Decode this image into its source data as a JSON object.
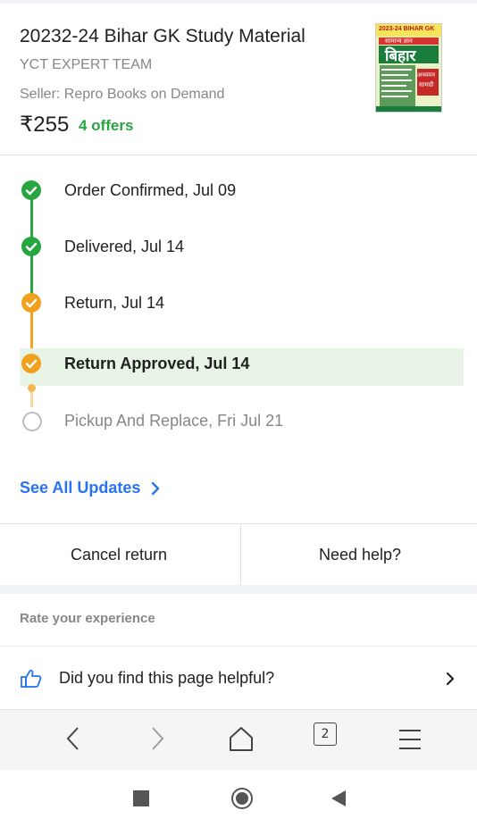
{
  "product": {
    "title": "20232-24 Bihar GK Study Material",
    "author": "YCT EXPERT TEAM",
    "seller": "Seller: Repro Books on Demand",
    "price": "₹255",
    "offers": "4 offers",
    "cover": {
      "top_text": "2023-24 BIHAR GK",
      "subtitle": "सामान्य ज्ञान",
      "main": "बिहार",
      "line2": "अध्ययन",
      "line3": "सामग्री"
    }
  },
  "timeline": {
    "steps": [
      {
        "label": "Order Confirmed, Jul 09",
        "status": "done-green"
      },
      {
        "label": "Delivered, Jul 14",
        "status": "done-green"
      },
      {
        "label": "Return, Jul 14",
        "status": "done-orange"
      },
      {
        "label": "Return Approved, Jul 14",
        "status": "current"
      },
      {
        "label": "Pickup And Replace, Fri Jul 21",
        "status": "pending"
      }
    ],
    "see_all": "See All Updates"
  },
  "actions": {
    "cancel_return": "Cancel return",
    "need_help": "Need help?"
  },
  "feedback": {
    "title": "Rate your experience",
    "question": "Did you find this page helpful?"
  },
  "browser": {
    "tab_count": "2"
  },
  "colors": {
    "green": "#26a541",
    "orange": "#f0a21e",
    "blue": "#2874f0",
    "highlight": "#e8f4e6"
  },
  "icons": [
    "check-icon",
    "chevron-right-icon",
    "thumbs-up-icon",
    "back-icon",
    "forward-icon",
    "home-icon",
    "tabs-icon",
    "menu-icon",
    "recent-apps-icon",
    "home-circle-icon",
    "back-triangle-icon"
  ]
}
